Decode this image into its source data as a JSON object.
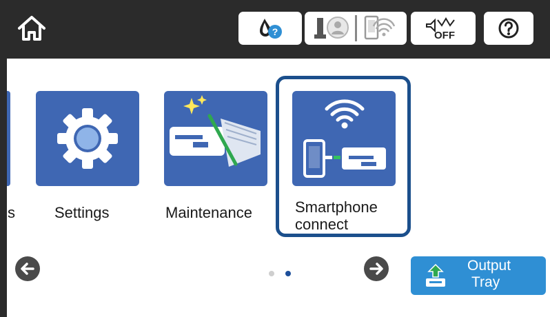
{
  "app": {
    "screen": "Home - page 2"
  },
  "status_bar": {
    "icons": [
      "home-icon",
      "ink-status-icon",
      "network-status-icon",
      "sound-off-icon",
      "help-icon"
    ],
    "colors": {
      "bar": "#2b2b2b",
      "help_accent": "#2f8fd4"
    }
  },
  "menu": {
    "items": [
      {
        "label": "s",
        "icon": "partial-icon"
      },
      {
        "label": "Settings",
        "icon": "gear-icon"
      },
      {
        "label": "Maintenance",
        "icon": "printer-maintenance-icon"
      },
      {
        "label": "Smartphone connect",
        "line1": "Smartphone",
        "line2": "connect",
        "icon": "smartphone-connect-icon",
        "selected": true
      }
    ]
  },
  "pagination": {
    "current_page": 2,
    "total_pages": 2
  },
  "output_tray": {
    "line1": "Output",
    "line2": "Tray",
    "icon": "output-tray-icon"
  },
  "colors": {
    "tile": "#3f67b3",
    "selection": "#1b4f8c",
    "button": "#2f8fd4"
  }
}
